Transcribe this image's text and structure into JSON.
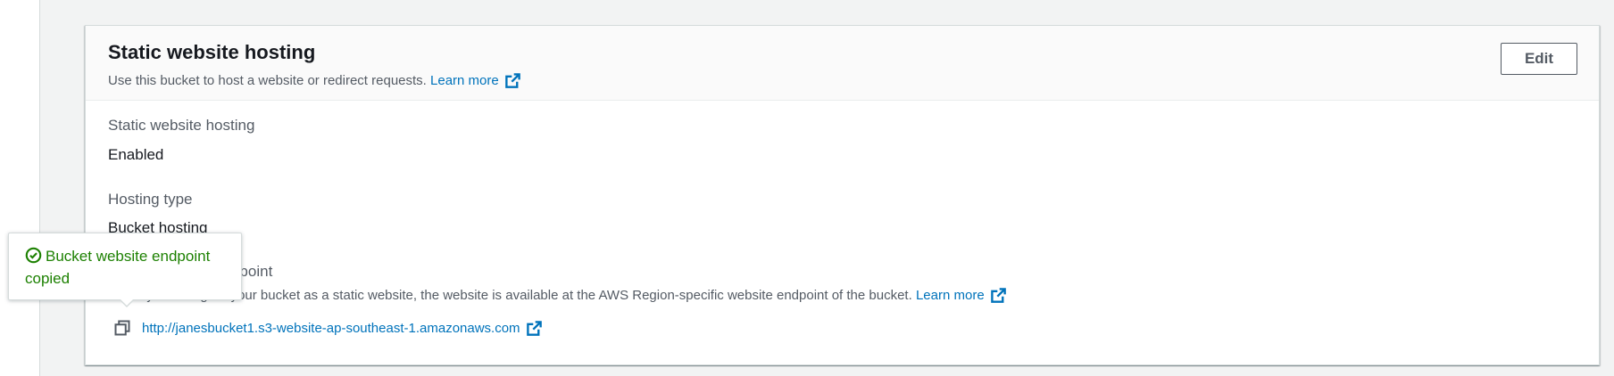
{
  "colors": {
    "link": "#0073bb",
    "success": "#1d8102",
    "label_text": "#545b64",
    "value_text": "#16191f",
    "page_background": "#f2f3f3"
  },
  "header": {
    "title": "Static website hosting",
    "description": "Use this bucket to host a website or redirect requests.",
    "learn_more": "Learn more",
    "learn_more_icon": "external-link-icon",
    "edit_label": "Edit"
  },
  "fields": {
    "hosting": {
      "label": "Static website hosting",
      "value": "Enabled"
    },
    "hosting_type": {
      "label": "Hosting type",
      "value": "Bucket hosting"
    },
    "endpoint": {
      "label": "Bucket website endpoint",
      "description": "When you configure your bucket as a static website, the website is available at the AWS Region-specific website endpoint of the bucket.",
      "learn_more": "Learn more",
      "learn_more_icon": "external-link-icon",
      "url": "http://janesbucket1.s3-website-ap-southeast-1.amazonaws.com",
      "url_icon": "external-link-icon",
      "copy_icon": "copy-icon"
    }
  },
  "toast": {
    "icon": "check-circle-icon",
    "message": "Bucket website endpoint copied"
  }
}
